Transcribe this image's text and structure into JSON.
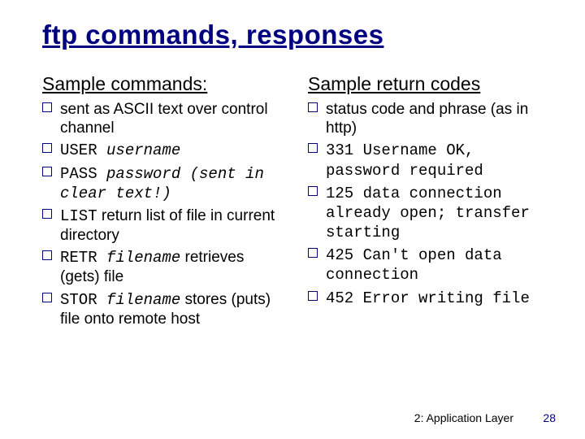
{
  "title": "ftp commands, responses",
  "left": {
    "heading": "Sample commands:",
    "items": [
      {
        "pre": "sent as ASCII text over control channel"
      },
      {
        "mono": "USER ",
        "monoi": "username"
      },
      {
        "mono": "PASS ",
        "monoi": "password (sent in clear text!)"
      },
      {
        "mono": "LIST",
        "post": " return list of file in current directory"
      },
      {
        "mono": "RETR ",
        "monoi2": "filename",
        "post": " retrieves (gets) file"
      },
      {
        "mono": "STOR ",
        "monoi2": "filename",
        "post": " stores (puts) file onto remote host"
      }
    ]
  },
  "right": {
    "heading": "Sample return codes",
    "items": [
      {
        "pre": "status code and phrase (as in http)"
      },
      {
        "mono": "331 Username OK, password required"
      },
      {
        "mono": "125 data connection already open; transfer starting"
      },
      {
        "mono": "425 Can't open data connection"
      },
      {
        "mono": "452 Error writing file"
      }
    ]
  },
  "footer": {
    "chapter": "2: Application Layer",
    "page": "28"
  }
}
